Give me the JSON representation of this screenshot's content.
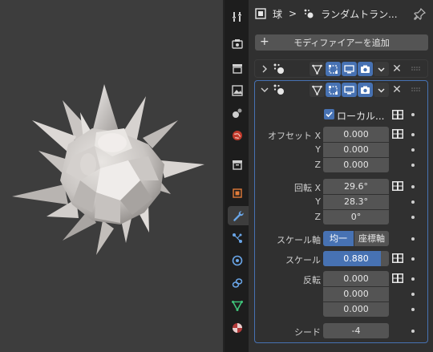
{
  "breadcrumb": {
    "object": "球",
    "modifier": "ランダムトラン..."
  },
  "add_modifier": "モディファイアーを追加",
  "modifier": {
    "local_label": "ローカル...",
    "offset": {
      "label": "オフセット",
      "x_label": "X",
      "y_label": "Y",
      "z_label": "Z",
      "x": "0.000",
      "y": "0.000",
      "z": "0.000"
    },
    "rotation": {
      "label": "回転",
      "x_label": "X",
      "y_label": "Y",
      "z_label": "Z",
      "x": "29.6°",
      "y": "28.3°",
      "z": "0°"
    },
    "scale_axis": {
      "label": "スケール軸",
      "uniform": "均一",
      "coords": "座標軸"
    },
    "scale": {
      "label": "スケール",
      "value": "0.880",
      "fill_fraction": 0.88
    },
    "flip": {
      "label": "反転",
      "a": "0.000",
      "b": "0.000",
      "c": "0.000"
    },
    "seed": {
      "label": "シード",
      "value": "-4"
    }
  },
  "colors": {
    "accent": "#4772b3",
    "panel_bg": "#303030",
    "viewport_bg": "#3d3d3d",
    "field_bg": "#545454"
  },
  "icons": [
    "tool-icon",
    "render-icon",
    "output-icon",
    "view-layer-icon",
    "scene-icon",
    "world-icon",
    "collection-icon",
    "object-icon",
    "modifier-wrench-icon",
    "particles-icon",
    "physics-icon",
    "constraints-icon",
    "data-icon",
    "material-icon"
  ]
}
